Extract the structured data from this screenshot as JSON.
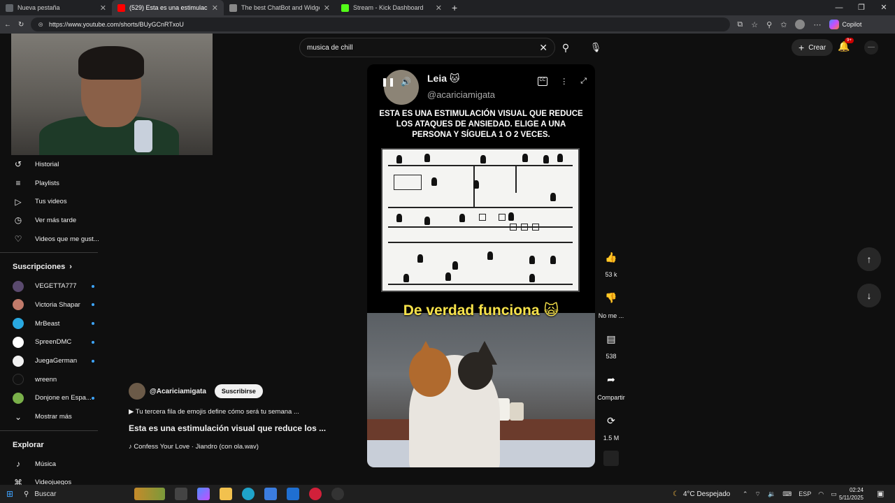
{
  "browser": {
    "tabs": [
      {
        "title": "Nueva pestaña",
        "icon": "new-tab-icon",
        "color": "#5f6368"
      },
      {
        "title": "(529) Esta es una estimulació",
        "icon": "youtube-icon",
        "color": "#ff0000"
      },
      {
        "title": "The best ChatBot and Widgets fo",
        "icon": "diamond-icon",
        "color": "#888888"
      },
      {
        "title": "Stream - Kick Dashboard",
        "icon": "kick-icon",
        "color": "#53fc18"
      }
    ],
    "new_tab": "+",
    "url": "https://www.youtube.com/shorts/BUyGCnRTxoU",
    "copilot": "Copilot"
  },
  "sidebar": {
    "items": [
      {
        "label": "Historial",
        "icon": "history-icon",
        "glyph": "↺"
      },
      {
        "label": "Playlists",
        "icon": "playlist-icon",
        "glyph": "≡"
      },
      {
        "label": "Tus videos",
        "icon": "video-icon",
        "glyph": "▷"
      },
      {
        "label": "Ver más tarde",
        "icon": "clock-icon",
        "glyph": "◷"
      },
      {
        "label": "Videos que me gust...",
        "icon": "like-icon",
        "glyph": "👍"
      }
    ],
    "subs_heading": "Suscripciones",
    "subs": [
      {
        "name": "VEGETTA777",
        "color": "#5a4a6e"
      },
      {
        "name": "Victoria Shapar",
        "color": "#c07a6a"
      },
      {
        "name": "MrBeast",
        "color": "#29a8e0"
      },
      {
        "name": "SpreenDMC",
        "color": "#ffffff"
      },
      {
        "name": "JuegaGerman",
        "color": "#f1f1f1"
      },
      {
        "name": "wreenn",
        "color": "#111111"
      },
      {
        "name": "Donjone en Espa...",
        "color": "#7ab04a"
      }
    ],
    "show_more": "Mostrar más",
    "explore_heading": "Explorar",
    "explore": [
      {
        "label": "Música",
        "icon": "music-icon",
        "glyph": "♪"
      },
      {
        "label": "Videojuegos",
        "icon": "gamepad-icon",
        "glyph": "🎮"
      }
    ]
  },
  "header": {
    "search_value": "musica de chill",
    "create_label": "Crear",
    "notif_badge": "9+"
  },
  "short": {
    "channel_name": "Leia 🐱",
    "channel_handle": "@acariciamigata",
    "caption": "ESTA ES UNA ESTIMULACIÓN VISUAL QUE REDUCE LOS ATAQUES DE ANSIEDAD. ELIGE A UNA PERSONA Y SÍGUELA 1 O 2 VECES.",
    "subtitle": "De verdad funciona 🙀"
  },
  "actions": [
    {
      "icon": "like-icon",
      "glyph": "👍",
      "label": "53 k"
    },
    {
      "icon": "dislike-icon",
      "glyph": "👎",
      "label": "No me ..."
    },
    {
      "icon": "comment-icon",
      "glyph": "▤",
      "label": "538"
    },
    {
      "icon": "share-icon",
      "glyph": "➦",
      "label": "Compartir"
    },
    {
      "icon": "remix-icon",
      "glyph": "⟳",
      "label": "1.5 M"
    }
  ],
  "video_info": {
    "channel": "@Acariciamigata",
    "subscribe": "Suscribirse",
    "description": "▶ Tu tercera fila de emojis define cómo será tu semana ...",
    "title": "Esta es una estimulación visual que reduce los ...",
    "music": "♪ Confess Your Love · Jiandro (con ola.wav)"
  },
  "taskbar": {
    "search": "Buscar",
    "weather": "4°C  Despejado",
    "lang": "ESP",
    "time": "02:24",
    "date": "5/11/2025"
  }
}
